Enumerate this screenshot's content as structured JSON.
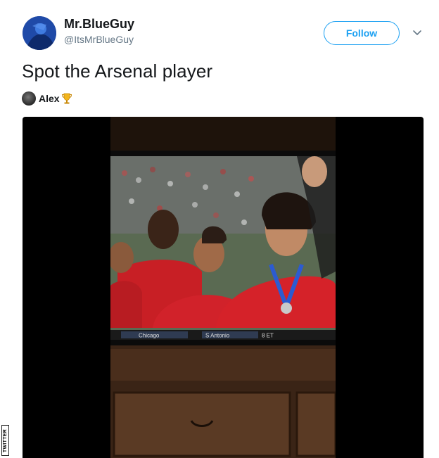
{
  "author": {
    "display_name": "Mr.BlueGuy",
    "handle": "@ItsMrBlueGuy",
    "avatar_icon": "avatar-image"
  },
  "follow_button": {
    "label": "Follow"
  },
  "more_menu_icon": "chevron-down-icon",
  "tweet": {
    "text": "Spot the Arsenal player",
    "mention_name": "Alex",
    "mention_emoji": "trophy-icon"
  },
  "media": {
    "type": "video-still",
    "scoreboard": {
      "left_text": "Chicago",
      "middle_text": "S Antonio",
      "right_text": "8 ET"
    }
  },
  "watermark": "TWITTER",
  "colors": {
    "accent": "#1da1f2",
    "text_primary": "#14171a",
    "text_secondary": "#657786"
  }
}
